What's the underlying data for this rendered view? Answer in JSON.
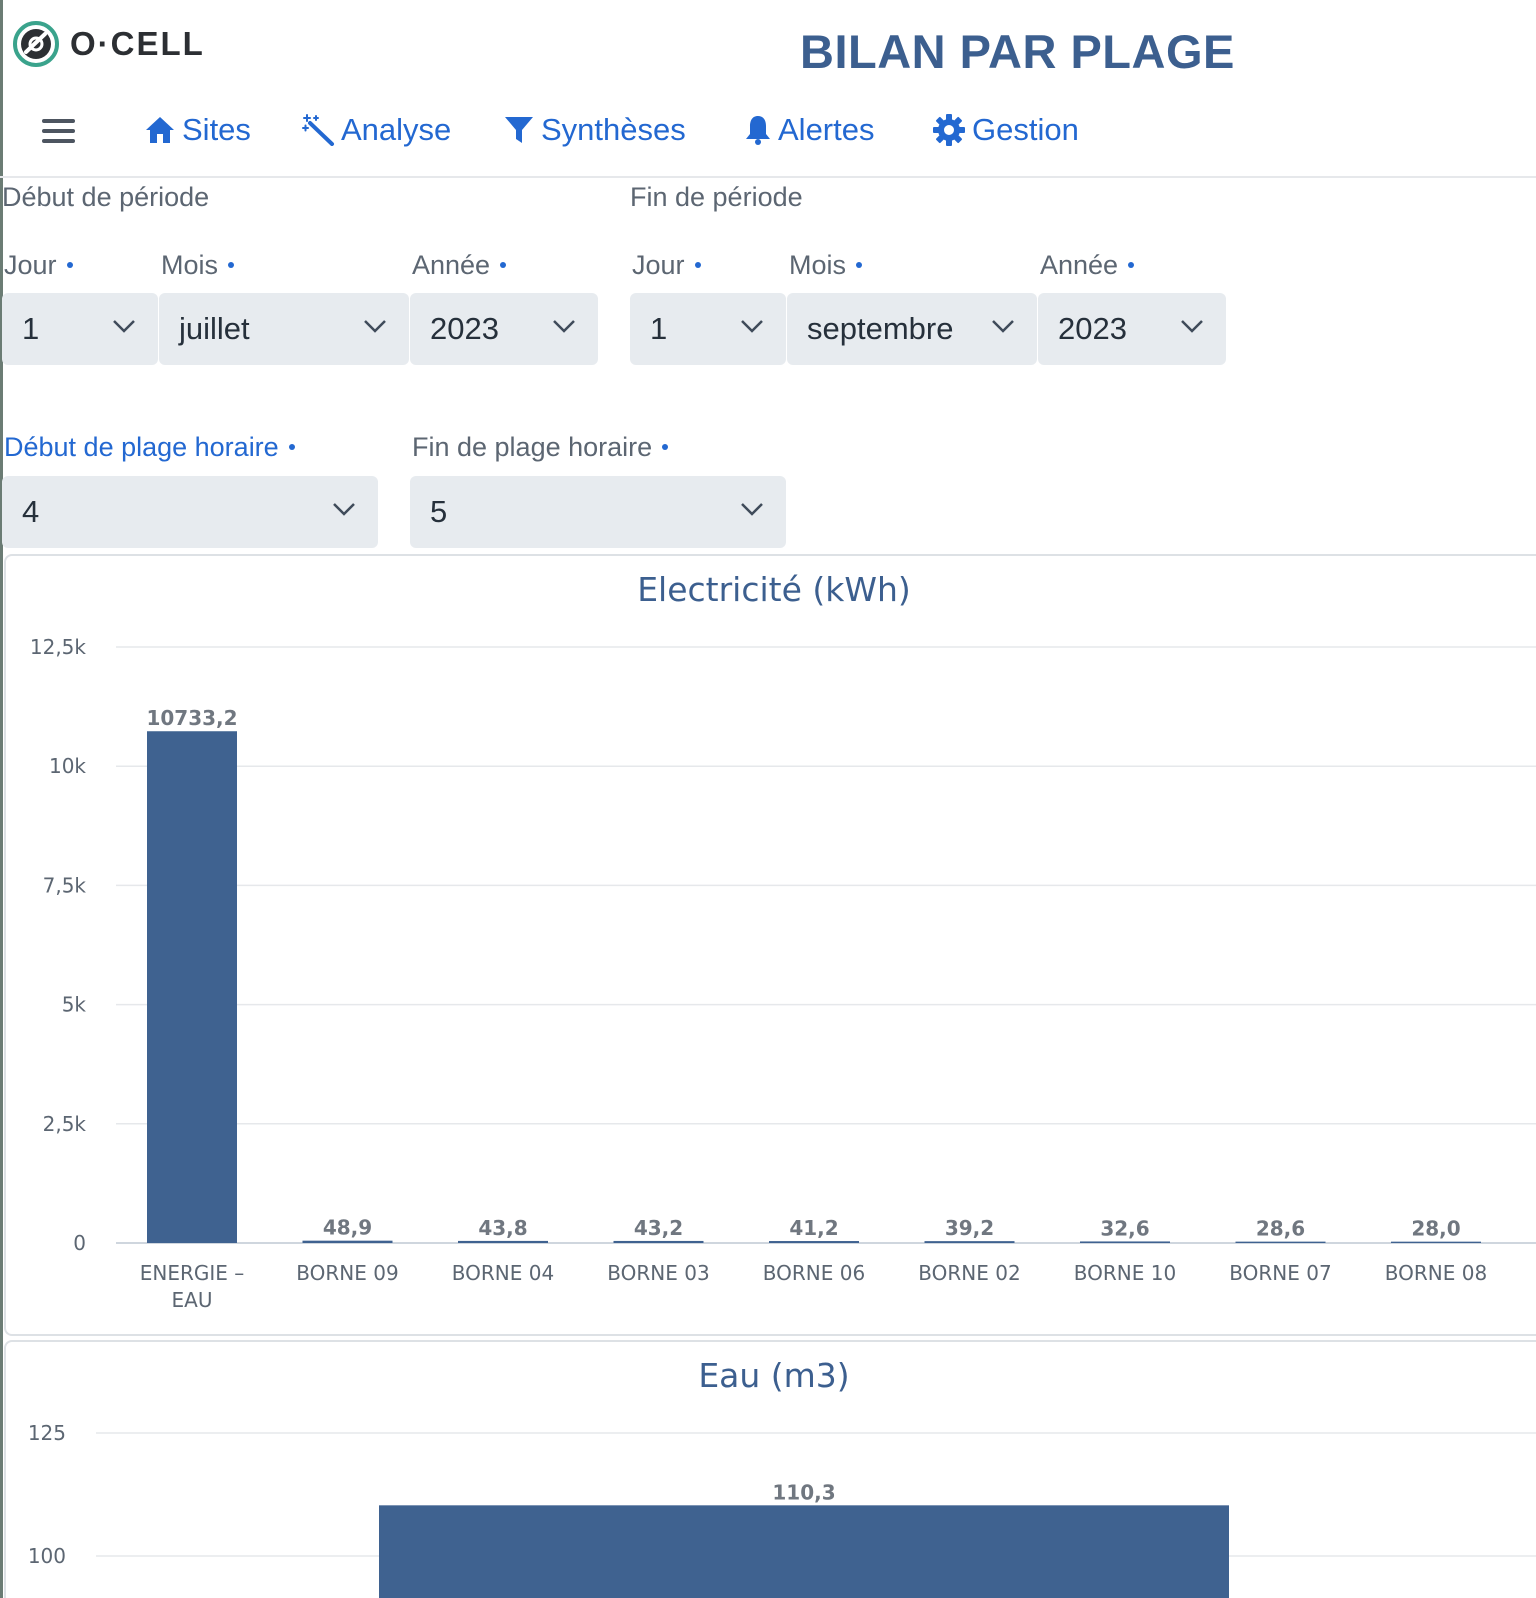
{
  "brand": {
    "name": "O·CELL"
  },
  "page_title": "BILAN PAR PLAGE",
  "nav": {
    "items": [
      {
        "label": "Sites",
        "icon": "home-icon"
      },
      {
        "label": "Analyse",
        "icon": "magic-wand-icon"
      },
      {
        "label": "Synthèses",
        "icon": "filter-icon"
      },
      {
        "label": "Alertes",
        "icon": "bell-icon"
      },
      {
        "label": "Gestion",
        "icon": "gear-icon"
      }
    ]
  },
  "period": {
    "start": {
      "label": "Début de période",
      "day": {
        "label": "Jour",
        "value": "1"
      },
      "month": {
        "label": "Mois",
        "value": "juillet"
      },
      "year": {
        "label": "Année",
        "value": "2023"
      }
    },
    "end": {
      "label": "Fin de période",
      "day": {
        "label": "Jour",
        "value": "1"
      },
      "month": {
        "label": "Mois",
        "value": "septembre"
      },
      "year": {
        "label": "Année",
        "value": "2023"
      }
    }
  },
  "time_range": {
    "start": {
      "label": "Début de plage horaire",
      "value": "4"
    },
    "end": {
      "label": "Fin de plage horaire",
      "value": "5"
    }
  },
  "colors": {
    "accent": "#2368d1",
    "bar": "#3f6290",
    "title": "#3c5f8f"
  },
  "chart_data": [
    {
      "type": "bar",
      "title": "Electricité (kWh)",
      "categories": [
        "ENERGIE - EAU",
        "BORNE 09",
        "BORNE 04",
        "BORNE 03",
        "BORNE 06",
        "BORNE 02",
        "BORNE 10",
        "BORNE 07",
        "BORNE 08"
      ],
      "values": [
        10733.2,
        48.9,
        43.8,
        43.2,
        41.2,
        39.2,
        32.6,
        28.6,
        28.0
      ],
      "value_labels": [
        "10733,2",
        "48,9",
        "43,8",
        "43,2",
        "41,2",
        "39,2",
        "32,6",
        "28,6",
        "28,0"
      ],
      "yticks": [
        "0",
        "2,5k",
        "5k",
        "7,5k",
        "10k",
        "12,5k"
      ],
      "ylim": [
        0,
        12500
      ],
      "grid": true
    },
    {
      "type": "bar",
      "title": "Eau (m3)",
      "values": [
        110.3
      ],
      "value_labels": [
        "110,3"
      ],
      "yticks": [
        "100",
        "125"
      ],
      "grid": true
    }
  ]
}
